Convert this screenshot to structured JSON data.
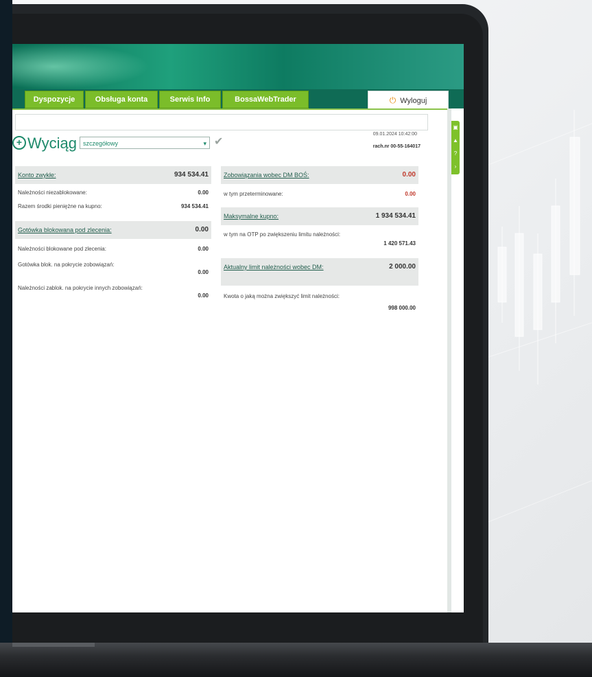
{
  "nav": {
    "tabs": [
      "Dyspozycje",
      "Obsługa konta",
      "Serwis Info",
      "BossaWebTrader"
    ],
    "logout_label": "Wyloguj"
  },
  "page": {
    "title": "Wyciąg",
    "view_select_value": "szczegółowy",
    "datetime": "09.01.2024 10:42:00",
    "account": "rach.nr 00-55-164017"
  },
  "left_panel": {
    "rows": [
      {
        "label": "Konto zwykłe:",
        "value": "934 534.41",
        "head": true
      },
      {
        "label": "Należności niezablokowane:",
        "value": "0.00"
      },
      {
        "label": "Razem środki pieniężne na kupno:",
        "value": "934 534.41"
      },
      {
        "label": "Gotówka blokowana pod zlecenia:",
        "value": "0.00",
        "head": true
      },
      {
        "label": "Należności blokowane pod zlecenia:",
        "value": "0.00"
      },
      {
        "label": "Gotówka blok. na pokrycie zobowiązań:",
        "value": "0.00"
      },
      {
        "label": "Należności zablok. na pokrycie innych zobowiązań:",
        "value": "0.00"
      }
    ]
  },
  "right_panel": {
    "rows": [
      {
        "label": "Zobowiązania wobec DM BOŚ:",
        "value": "0.00",
        "head": true,
        "value_color": "red"
      },
      {
        "label": "w tym przeterminowane:",
        "value": "0.00",
        "value_color": "red"
      },
      {
        "label": "Maksymalne kupno:",
        "value": "1 934 534.41",
        "head": true
      },
      {
        "label": "w tym na OTP po zwiększeniu limitu należności:",
        "value": "1 420 571.43"
      },
      {
        "label": "Aktualny limit należności wobec DM:",
        "value": "2 000.00",
        "head": true
      },
      {
        "label": "Kwota o jaką można zwiększyć limit należności:",
        "value": "998 000.00"
      }
    ]
  },
  "colors": {
    "brand_green": "#1e8a6b",
    "tab_green": "#7bbd2a",
    "negative_red": "#c0392b"
  }
}
